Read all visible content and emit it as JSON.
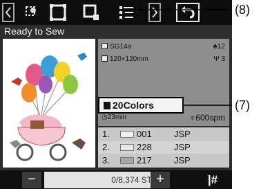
{
  "status": {
    "text": "Ready to Sew"
  },
  "info": {
    "size": "SG14a",
    "people_count": "12",
    "dimensions": "120×120mm",
    "hoop_level": "3",
    "colors": "20Colors",
    "time": "23min",
    "speed": "600spm"
  },
  "color_list": [
    {
      "index": "1.",
      "code": "001",
      "brand": "JSP",
      "color": "#f0f0f0"
    },
    {
      "index": "2.",
      "code": "228",
      "brand": "JSP",
      "color": "#e8e8e8"
    },
    {
      "index": "3.",
      "code": "217",
      "brand": "JSP",
      "color": "#a8a8a8"
    }
  ],
  "stitch_counter": {
    "text": "0/8,374 ST"
  },
  "buttons": {
    "minus": "−",
    "plus": "+",
    "jump": "|#"
  },
  "callouts": {
    "top": "(8)",
    "middle": "(7)"
  }
}
